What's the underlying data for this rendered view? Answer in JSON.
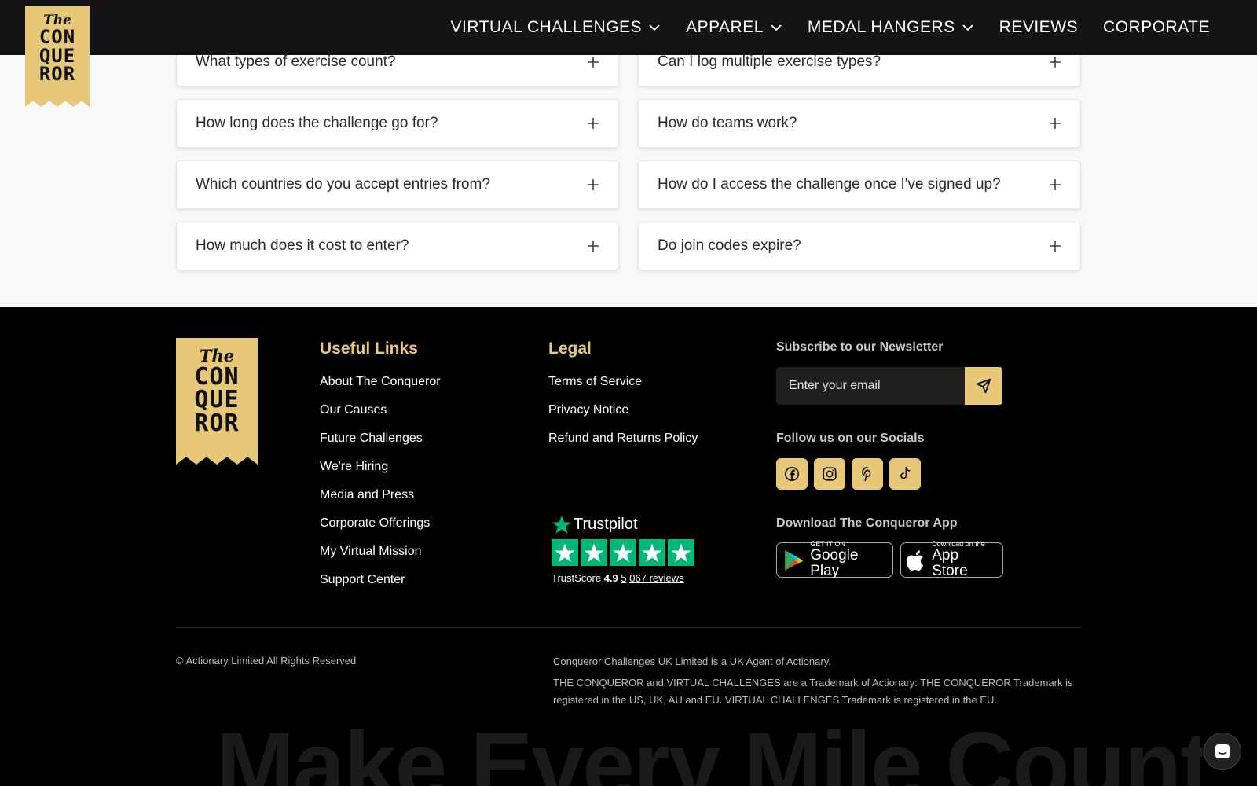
{
  "nav": {
    "items": [
      {
        "label": "VIRTUAL CHALLENGES",
        "has_dropdown": true
      },
      {
        "label": "APPAREL",
        "has_dropdown": true
      },
      {
        "label": "MEDAL HANGERS",
        "has_dropdown": true
      },
      {
        "label": "REVIEWS",
        "has_dropdown": false
      },
      {
        "label": "CORPORATE",
        "has_dropdown": false
      }
    ]
  },
  "logo": {
    "the": "The",
    "line1": "CON",
    "line2": "QUE",
    "line3": "ROR"
  },
  "faq": {
    "left": [
      "What types of exercise count?",
      "How long does the challenge go for?",
      "Which countries do you accept entries from?",
      "How much does it cost to enter?"
    ],
    "right": [
      "Can I log multiple exercise types?",
      "How do teams work?",
      "How do I access the challenge once I've signed up?",
      "Do join codes expire?"
    ]
  },
  "footer": {
    "useful_links": {
      "title": "Useful Links",
      "items": [
        "About The Conqueror",
        "Our Causes",
        "Future Challenges",
        "We're Hiring",
        "Media and Press",
        "Corporate Offerings",
        "My Virtual Mission",
        "Support Center"
      ]
    },
    "legal": {
      "title": "Legal",
      "items": [
        "Terms of Service",
        "Privacy Notice",
        "Refund and Returns Policy"
      ]
    },
    "newsletter": {
      "label": "Subscribe to our Newsletter",
      "placeholder": "Enter your email"
    },
    "socials": {
      "label": "Follow us on our Socials",
      "icons": [
        "facebook-icon",
        "instagram-icon",
        "pinterest-icon",
        "tiktok-icon"
      ]
    },
    "app": {
      "label": "Download The Conqueror App",
      "google_small": "GET IT ON",
      "google_big": "Google Play",
      "apple_small": "Download on the",
      "apple_big": "App Store"
    },
    "trustpilot": {
      "brand": "Trustpilot",
      "score_label": "TrustScore",
      "score": "4.9",
      "reviews": "5,067 reviews",
      "stars": 5
    },
    "copyright": "© Actionary Limited All Rights Reserved",
    "legal_note_1": "Conqueror Challenges UK Limited is a UK Agent of Actionary.",
    "legal_note_2": "THE CONQUEROR and VIRTUAL CHALLENGES are a Trademark of Actionary: THE CONQUEROR Trademark is registered in the US, UK, AU and EU. VIRTUAL CHALLENGES Trademark is registered in the EU.",
    "slogan": "Make Every Mile Count"
  },
  "colors": {
    "accent": "#e6c878",
    "trustpilot": "#00b67a",
    "footer_bg": "#000000",
    "nav_bg": "#141414"
  }
}
